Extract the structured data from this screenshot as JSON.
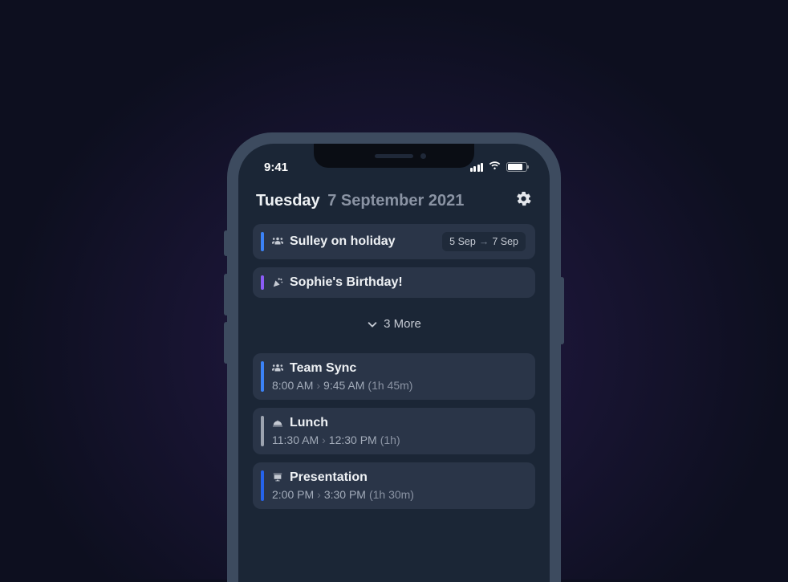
{
  "status_bar": {
    "time": "9:41"
  },
  "header": {
    "day": "Tuesday",
    "date": "7 September 2021"
  },
  "allday_events": [
    {
      "title": "Sulley on holiday",
      "icon": "people-icon",
      "color": "#3b82f6",
      "date_from": "5 Sep",
      "date_to": "7 Sep"
    },
    {
      "title": "Sophie's Birthday!",
      "icon": "party-icon",
      "color": "#8b5cf6"
    }
  ],
  "more_label": "3 More",
  "timed_events": [
    {
      "title": "Team Sync",
      "icon": "people-icon",
      "color": "#3b82f6",
      "start": "8:00 AM",
      "end": "9:45 AM",
      "duration": "(1h 45m)"
    },
    {
      "title": "Lunch",
      "icon": "food-icon",
      "color": "#9ca3af",
      "start": "11:30 AM",
      "end": "12:30 PM",
      "duration": "(1h)"
    },
    {
      "title": "Presentation",
      "icon": "presentation-icon",
      "color": "#2563eb",
      "start": "2:00 PM",
      "end": "3:30 PM",
      "duration": "(1h 30m)"
    }
  ]
}
